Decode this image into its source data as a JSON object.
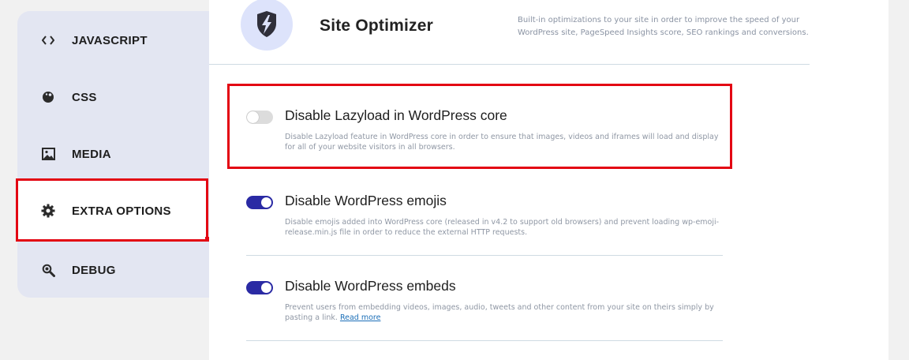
{
  "sidebar": {
    "items": [
      {
        "label": "JAVASCRIPT",
        "icon": "code-icon"
      },
      {
        "label": "CSS",
        "icon": "palette-icon"
      },
      {
        "label": "MEDIA",
        "icon": "image-icon"
      },
      {
        "label": "EXTRA OPTIONS",
        "icon": "gear-icon"
      },
      {
        "label": "DEBUG",
        "icon": "magnify-icon"
      }
    ],
    "active_index": 3
  },
  "header": {
    "title": "Site Optimizer",
    "description": "Built-in optimizations to your site in order to improve the speed of your WordPress site, PageSpeed Insights score, SEO rankings and conversions."
  },
  "options": [
    {
      "title": "Disable Lazyload in WordPress core",
      "description": "Disable Lazyload feature in WordPress core in order to ensure that images, videos and iframes will load and display for all of your website visitors in all browsers.",
      "enabled": false
    },
    {
      "title": "Disable WordPress emojis",
      "description": "Disable emojis added into WordPress core (released in v4.2 to support old browsers) and prevent loading wp-emoji-release.min.js file in order to reduce the external HTTP requests.",
      "enabled": true
    },
    {
      "title": "Disable WordPress embeds",
      "description": "Prevent users from embedding videos, images, audio, tweets and other content from your site on theirs simply by pasting a link.",
      "link_text": "Read more",
      "enabled": true
    }
  ],
  "colors": {
    "highlight": "#e30613",
    "toggle_on": "#2a2aa4",
    "sidebar_bg": "#e3e6f2"
  }
}
